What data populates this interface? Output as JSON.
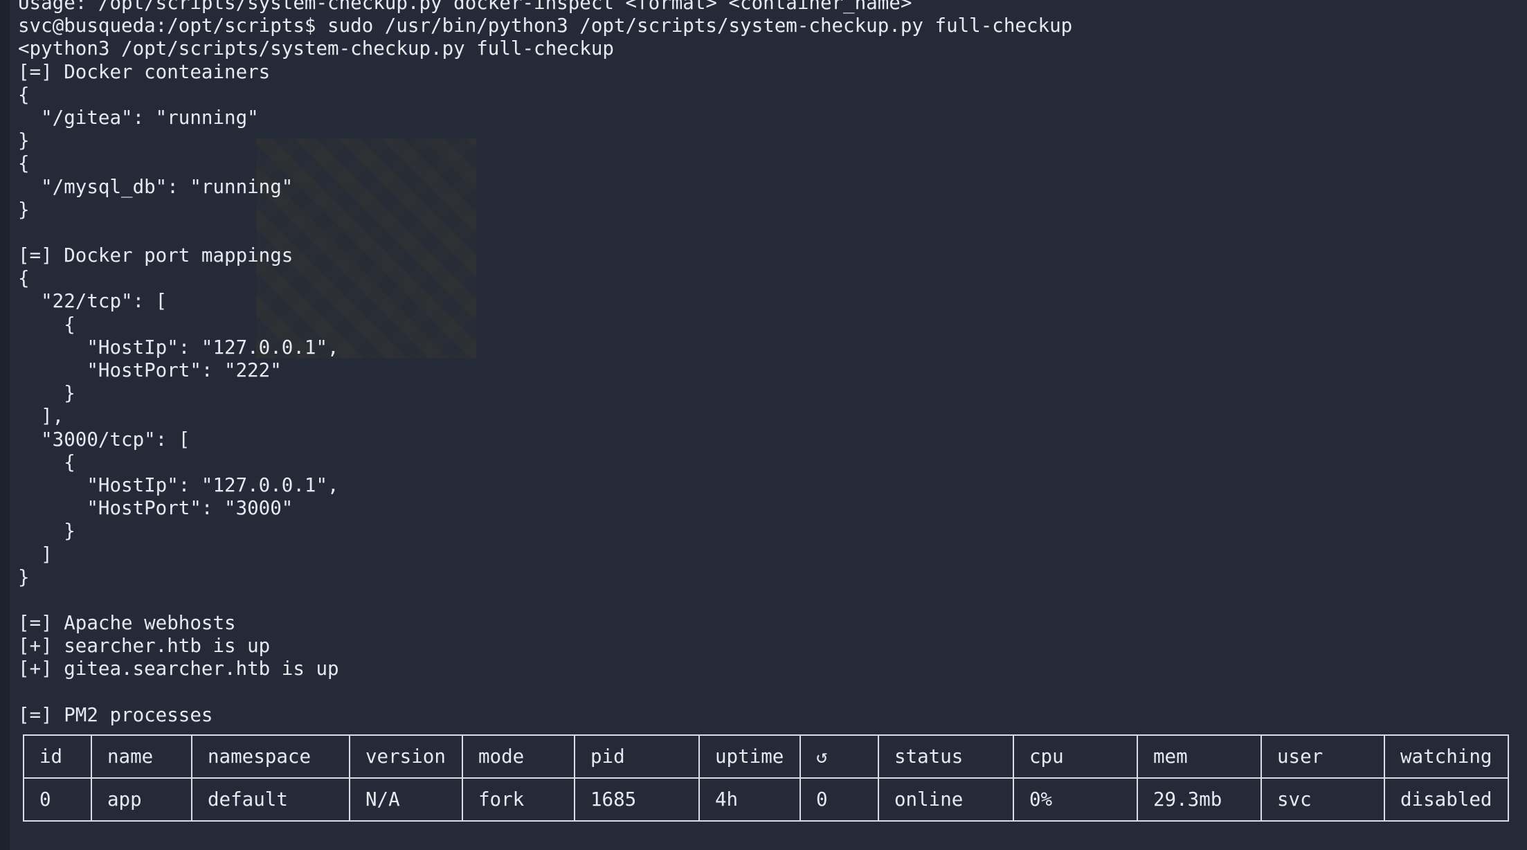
{
  "terminal": {
    "lines": [
      "Usage: /opt/scripts/system-checkup.py docker-inspect <format> <container_name>",
      "svc@busqueda:/opt/scripts$ sudo /usr/bin/python3 /opt/scripts/system-checkup.py full-checkup",
      "<python3 /opt/scripts/system-checkup.py full-checkup",
      "[=] Docker conteainers",
      "{",
      "  \"/gitea\": \"running\"",
      "}",
      "{",
      "  \"/mysql_db\": \"running\"",
      "}",
      "",
      "[=] Docker port mappings",
      "{",
      "  \"22/tcp\": [",
      "    {",
      "      \"HostIp\": \"127.0.0.1\",",
      "      \"HostPort\": \"222\"",
      "    }",
      "  ],",
      "  \"3000/tcp\": [",
      "    {",
      "      \"HostIp\": \"127.0.0.1\",",
      "      \"HostPort\": \"3000\"",
      "    }",
      "  ]",
      "}",
      "",
      "[=] Apache webhosts",
      "[+] searcher.htb is up",
      "[+] gitea.searcher.htb is up",
      "",
      "[=] PM2 processes"
    ]
  },
  "pm2_table": {
    "headers": [
      "id",
      "name",
      "namespace",
      "version",
      "mode",
      "pid",
      "uptime",
      "↺",
      "status",
      "cpu",
      "mem",
      "user",
      "watching"
    ],
    "rows": [
      [
        "0",
        "app",
        "default",
        "N/A",
        "fork",
        "1685",
        "4h",
        "0",
        "online",
        "0%",
        "29.3mb",
        "svc",
        "disabled"
      ]
    ]
  },
  "colors": {
    "background": "#252a38",
    "foreground": "#e6e9ef",
    "table_border": "#d9dde6"
  }
}
